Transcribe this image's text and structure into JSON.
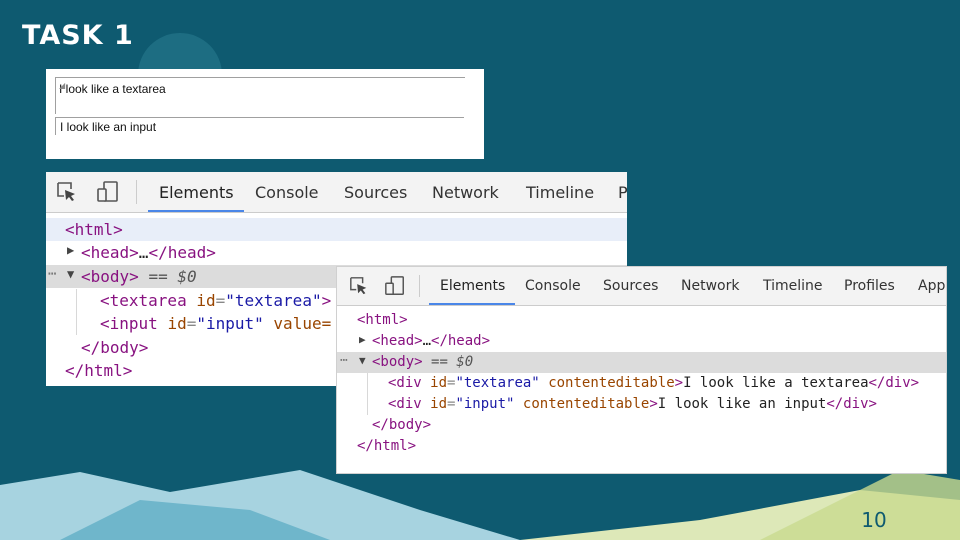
{
  "slide": {
    "title": "TASK 1",
    "page_number": "10"
  },
  "rendered_page": {
    "textarea_text": "I look like a textarea",
    "input_text": "I look like an input"
  },
  "devtools_before": {
    "tabs": [
      "Elements",
      "Console",
      "Sources",
      "Network",
      "Timeline",
      "P"
    ],
    "active_tab": "Elements",
    "dom": {
      "html_open": "<html>",
      "head_open": "<head>",
      "ellipsis": "…",
      "head_close": "</head>",
      "body_open": "<body>",
      "selected_marker": "== $0",
      "textarea_tag": "<textarea",
      "textarea_attr": "id",
      "textarea_val": "\"textarea\"",
      "textarea_end": ">",
      "input_tag": "<input",
      "input_attr": "id",
      "input_val": "\"input\"",
      "input_attr2": "value=",
      "body_close": "</body>",
      "html_close": "</html>"
    }
  },
  "devtools_after": {
    "tabs": [
      "Elements",
      "Console",
      "Sources",
      "Network",
      "Timeline",
      "Profiles",
      "App"
    ],
    "active_tab": "Elements",
    "dom": {
      "html_open": "<html>",
      "head_open": "<head>",
      "ellipsis": "…",
      "head_close": "</head>",
      "body_open": "<body>",
      "selected_marker": "== $0",
      "div1_tag": "<div",
      "div1_attr": "id",
      "div1_val": "\"textarea\"",
      "div1_attr2": "contenteditable",
      "div1_text": "I look like a textarea",
      "div1_close": "</div>",
      "div2_tag": "<div",
      "div2_attr": "id",
      "div2_val": "\"input\"",
      "div2_attr2": "contenteditable",
      "div2_text": "I look like an input",
      "div2_close": "</div>",
      "body_close": "</body>",
      "html_close": "</html>"
    }
  },
  "colors": {
    "background": "#0e5a70",
    "accent_light": "#a7d3e0",
    "accent_pale": "#dde8b8",
    "tag": "#881280",
    "attribute": "#994500",
    "value": "#1a1aa6",
    "tab_underline": "#4a86e8"
  },
  "icons": [
    "inspect-cursor-icon",
    "device-mode-icon",
    "expand-triangle-icon",
    "collapse-triangle-icon",
    "resize-grip-icon"
  ]
}
